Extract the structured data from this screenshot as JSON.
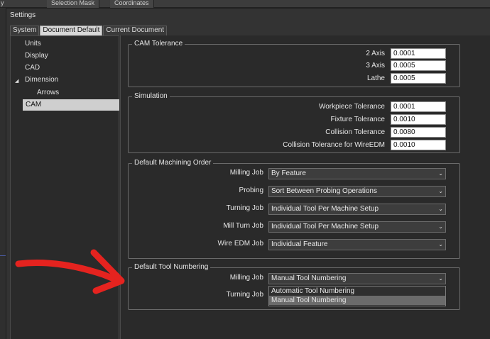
{
  "background": {
    "left_text": "y",
    "tabs": [
      "Selection Mask",
      "Coordinates"
    ]
  },
  "window": {
    "title": "Settings"
  },
  "tabs": [
    {
      "label": "System",
      "active": false
    },
    {
      "label": "Document Default",
      "active": true
    },
    {
      "label": "Current Document",
      "active": false
    }
  ],
  "tree": {
    "items": [
      {
        "label": "Units"
      },
      {
        "label": "Display"
      },
      {
        "label": "CAD"
      },
      {
        "label": "Dimension",
        "expanded": true
      },
      {
        "label": "Arrows"
      },
      {
        "label": "CAM",
        "selected": true
      }
    ]
  },
  "cam_tolerance": {
    "title": "CAM Tolerance",
    "rows": [
      {
        "label": "2 Axis",
        "value": "0.0001"
      },
      {
        "label": "3 Axis",
        "value": "0.0005"
      },
      {
        "label": "Lathe",
        "value": "0.0005"
      }
    ]
  },
  "simulation": {
    "title": "Simulation",
    "rows": [
      {
        "label": "Workpiece Tolerance",
        "value": "0.0001"
      },
      {
        "label": "Fixture Tolerance",
        "value": "0.0010"
      },
      {
        "label": "Collision Tolerance",
        "value": "0.0080"
      },
      {
        "label": "Collision Tolerance for WireEDM",
        "value": "0.0010"
      }
    ]
  },
  "machining_order": {
    "title": "Default Machining Order",
    "rows": [
      {
        "label": "Milling Job",
        "value": "By Feature"
      },
      {
        "label": "Probing",
        "value": "Sort Between Probing Operations"
      },
      {
        "label": "Turning Job",
        "value": "Individual Tool Per Machine Setup"
      },
      {
        "label": "Mill Turn Job",
        "value": "Individual Tool Per Machine Setup"
      },
      {
        "label": "Wire EDM Job",
        "value": "Individual Feature"
      }
    ]
  },
  "tool_numbering": {
    "title": "Default Tool Numbering",
    "milling_label": "Milling Job",
    "milling_value": "Manual Tool Numbering",
    "turning_label": "Turning Job",
    "dropdown_options": [
      "Automatic Tool Numbering",
      "Manual Tool Numbering"
    ],
    "highlighted_index": 1
  },
  "colors": {
    "annotation_arrow": "#e5231f",
    "panel_bg": "#2a2a2a"
  }
}
